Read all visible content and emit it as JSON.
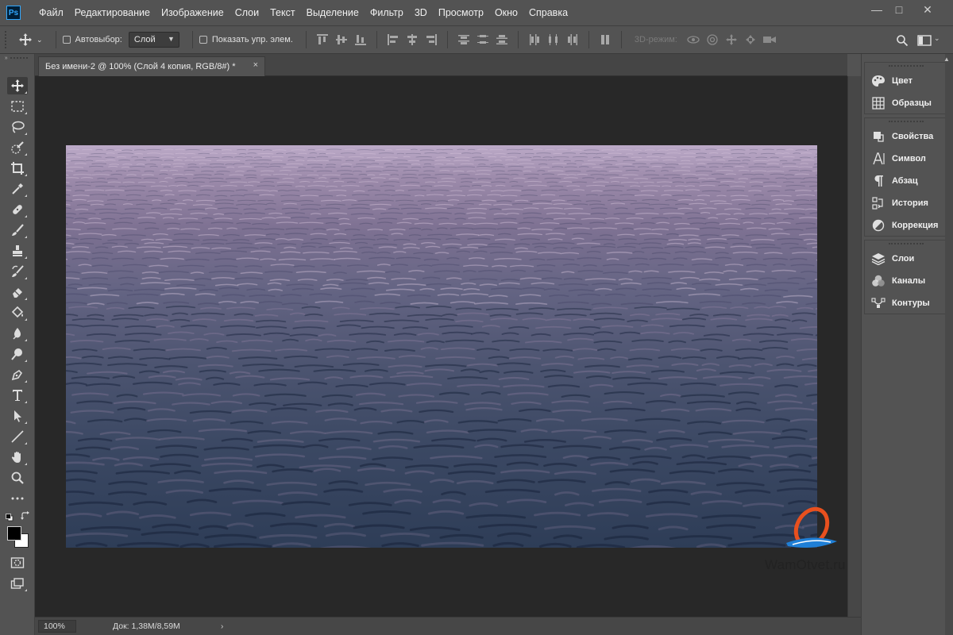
{
  "app": {
    "logo_text": "Ps"
  },
  "menu": [
    "Файл",
    "Редактирование",
    "Изображение",
    "Слои",
    "Текст",
    "Выделение",
    "Фильтр",
    "3D",
    "Просмотр",
    "Окно",
    "Справка"
  ],
  "window_controls": {
    "minimize": "—",
    "maximize": "□",
    "close": "✕"
  },
  "options": {
    "auto_select_label": "Автовыбор:",
    "auto_select_value": "Слой",
    "show_transform_label": "Показать упр. элем.",
    "mode_3d_label": "3D-режим:"
  },
  "document": {
    "tab_title": "Без имени-2 @ 100% (Слой 4 копия, RGB/8#) *",
    "tab_close": "×",
    "zoom": "100%",
    "doc_size": "Док: 1,38M/8,59M",
    "status_arrow": "›"
  },
  "panels": {
    "group1": [
      {
        "icon": "palette-icon",
        "label": "Цвет"
      },
      {
        "icon": "grid-icon",
        "label": "Образцы"
      }
    ],
    "group2": [
      {
        "icon": "properties-icon",
        "label": "Свойства"
      },
      {
        "icon": "character-icon",
        "label": "Символ"
      },
      {
        "icon": "paragraph-icon",
        "label": "Абзац"
      },
      {
        "icon": "history-icon",
        "label": "История"
      },
      {
        "icon": "adjustments-icon",
        "label": "Коррекция"
      }
    ],
    "group3": [
      {
        "icon": "layers-icon",
        "label": "Слои"
      },
      {
        "icon": "channels-icon",
        "label": "Каналы"
      },
      {
        "icon": "paths-icon",
        "label": "Контуры"
      }
    ]
  },
  "watermark": {
    "text": "WamOtvet.ru"
  },
  "colors": {
    "foreground": "#000000",
    "background": "#ffffff",
    "accent": "#31a8ff"
  }
}
